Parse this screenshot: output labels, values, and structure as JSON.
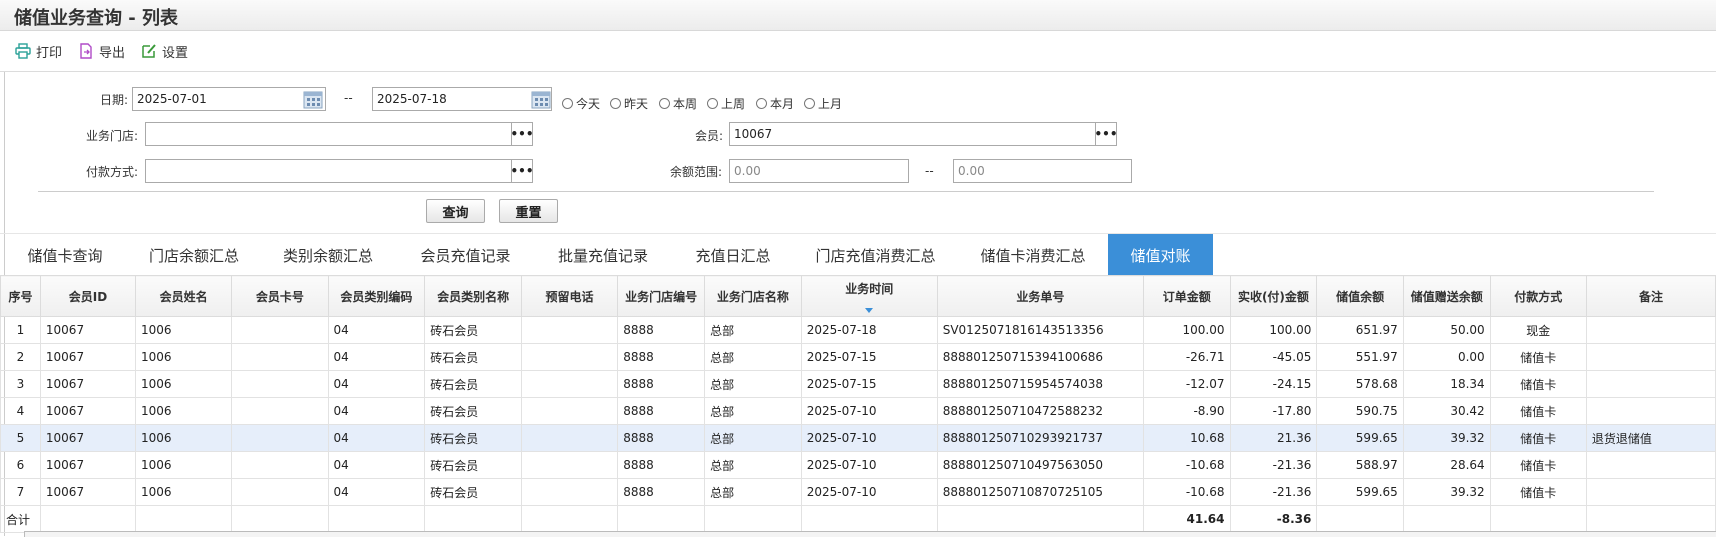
{
  "window": {
    "title": "储值业务查询 - 列表"
  },
  "toolbar": {
    "print": "打印",
    "export": "导出",
    "settings": "设置"
  },
  "filters": {
    "date_label": "日期:",
    "date_from": "2025-07-01",
    "date_sep": "--",
    "date_to": "2025-07-18",
    "quick_ranges": [
      "今天",
      "昨天",
      "本周",
      "上周",
      "本月",
      "上月"
    ],
    "store_label": "业务门店:",
    "store_value": "",
    "member_label": "会员:",
    "member_value": "10067",
    "pay_label": "付款方式:",
    "pay_value": "",
    "range_label": "余额范围:",
    "range_min_placeholder": "0.00",
    "range_sep": "--",
    "range_max_placeholder": "0.00",
    "dots": "•••",
    "query_button": "查询",
    "reset_button": "重置"
  },
  "tabs": [
    "储值卡查询",
    "门店余额汇总",
    "类别余额汇总",
    "会员充值记录",
    "批量充值记录",
    "充值日汇总",
    "门店充值消费汇总",
    "储值卡消费汇总",
    "储值对账"
  ],
  "active_tab": 8,
  "grid": {
    "columns": [
      "序号",
      "会员ID",
      "会员姓名",
      "会员卡号",
      "会员类别编码",
      "会员类别名称",
      "预留电话",
      "业务门店编号",
      "业务门店名称",
      "业务时间",
      "业务单号",
      "订单金额",
      "实收(付)金额",
      "储值余额",
      "储值赠送余额",
      "付款方式",
      "备注"
    ],
    "rows": [
      [
        "1",
        "10067",
        "1006",
        "",
        "04",
        "砖石会员",
        "",
        "8888",
        "总部",
        "2025-07-18",
        "SV0125071816143513356",
        "100.00",
        "100.00",
        "651.97",
        "50.00",
        "现金",
        ""
      ],
      [
        "2",
        "10067",
        "1006",
        "",
        "04",
        "砖石会员",
        "",
        "8888",
        "总部",
        "2025-07-15",
        "888801250715394100686",
        "-26.71",
        "-45.05",
        "551.97",
        "0.00",
        "储值卡",
        ""
      ],
      [
        "3",
        "10067",
        "1006",
        "",
        "04",
        "砖石会员",
        "",
        "8888",
        "总部",
        "2025-07-15",
        "888801250715954574038",
        "-12.07",
        "-24.15",
        "578.68",
        "18.34",
        "储值卡",
        ""
      ],
      [
        "4",
        "10067",
        "1006",
        "",
        "04",
        "砖石会员",
        "",
        "8888",
        "总部",
        "2025-07-10",
        "888801250710472588232",
        "-8.90",
        "-17.80",
        "590.75",
        "30.42",
        "储值卡",
        ""
      ],
      [
        "5",
        "10067",
        "1006",
        "",
        "04",
        "砖石会员",
        "",
        "8888",
        "总部",
        "2025-07-10",
        "888801250710293921737",
        "10.68",
        "21.36",
        "599.65",
        "39.32",
        "储值卡",
        "退货退储值"
      ],
      [
        "6",
        "10067",
        "1006",
        "",
        "04",
        "砖石会员",
        "",
        "8888",
        "总部",
        "2025-07-10",
        "888801250710497563050",
        "-10.68",
        "-21.36",
        "588.97",
        "28.64",
        "储值卡",
        ""
      ],
      [
        "7",
        "10067",
        "1006",
        "",
        "04",
        "砖石会员",
        "",
        "8888",
        "总部",
        "2025-07-10",
        "888801250710870725105",
        "-10.68",
        "-21.36",
        "599.65",
        "39.32",
        "储值卡",
        ""
      ]
    ],
    "highlighted_row": 4,
    "total": {
      "label": "合计",
      "order_amount": "41.64",
      "paid_amount": "-8.36"
    }
  },
  "colors": {
    "accent": "#3b8fd8",
    "row_highlight": "#e6eefa"
  },
  "icons": {
    "print": "printer-icon",
    "export": "export-file-icon",
    "settings": "edit-settings-icon",
    "calendar": "calendar-icon",
    "sort": "sort-desc-icon"
  }
}
